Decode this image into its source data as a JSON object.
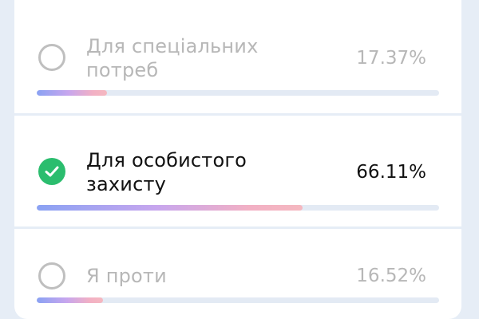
{
  "poll": {
    "options": [
      {
        "label": "Для спеціальних потреб",
        "percent_text": "17.37%",
        "percent": 17.37,
        "selected": false
      },
      {
        "label": "Для особистого захисту",
        "percent_text": "66.11%",
        "percent": 66.11,
        "selected": true
      },
      {
        "label": "Я проти",
        "percent_text": "16.52%",
        "percent": 16.52,
        "selected": false
      }
    ]
  },
  "colors": {
    "selected_check": "#2bbd6e",
    "muted_text": "#b7b7b7",
    "active_text": "#111111",
    "bar_track": "#e3eaf4"
  }
}
